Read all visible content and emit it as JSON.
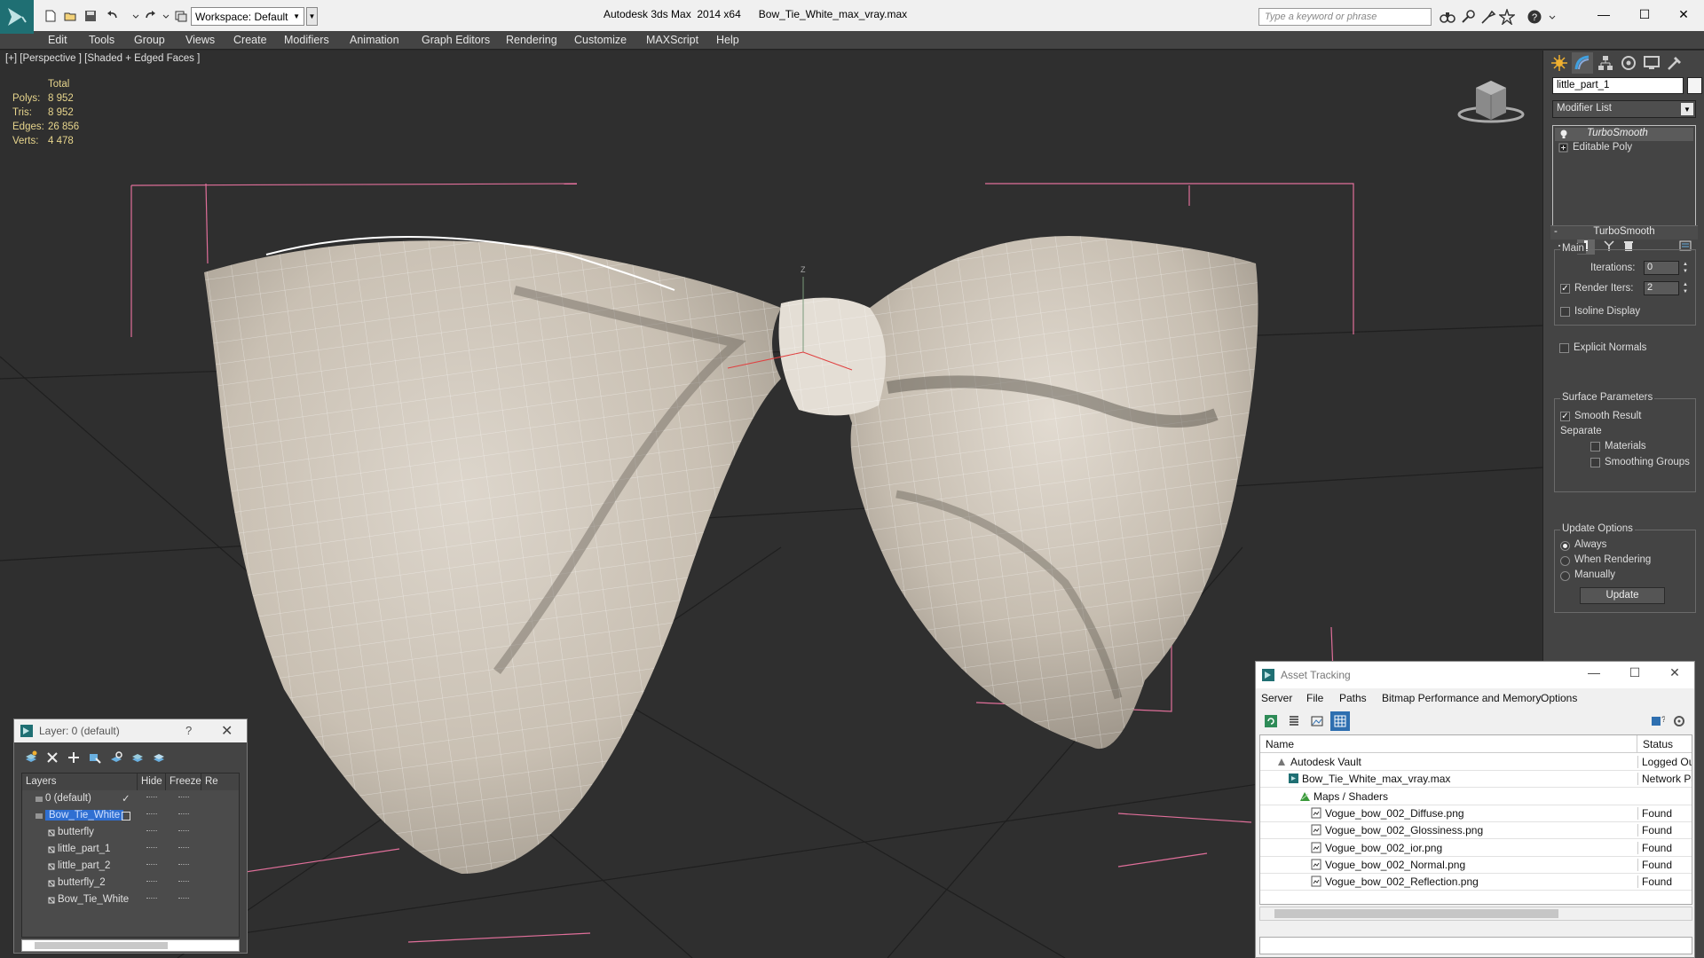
{
  "app": {
    "title": "Autodesk 3ds Max  2014 x64      Bow_Tie_White_max_vray.max",
    "workspace": "Workspace: Default",
    "search_placeholder": "Type a keyword or phrase",
    "accent_color": "#1f6f73"
  },
  "menu": [
    "Edit",
    "Tools",
    "Group",
    "Views",
    "Create",
    "Modifiers",
    "Animation",
    "Graph Editors",
    "Rendering",
    "Customize",
    "MAXScript",
    "Help"
  ],
  "viewport": {
    "label": "[+] [Perspective ] [Shaded + Edged Faces ]",
    "stats": {
      "header": "Total",
      "rows": [
        {
          "k": "Polys:",
          "v": "8 952"
        },
        {
          "k": "Tris:",
          "v": "8 952"
        },
        {
          "k": "Edges:",
          "v": "26 856"
        },
        {
          "k": "Verts:",
          "v": "4 478"
        }
      ]
    },
    "axis_label": "Z"
  },
  "command_panel": {
    "object_name": "little_part_1",
    "modifier_list": "Modifier List",
    "stack": [
      "TurboSmooth",
      "Editable Poly"
    ],
    "rollout_title": "TurboSmooth",
    "main_group": "Main",
    "iterations_label": "Iterations:",
    "iterations_value": "0",
    "render_iters_label": "Render Iters:",
    "render_iters_value": "2",
    "isoline_display": "Isoline Display",
    "explicit_normals": "Explicit Normals",
    "surface_group": "Surface Parameters",
    "smooth_result": "Smooth Result",
    "separate_label": "Separate",
    "materials": "Materials",
    "smoothing_groups": "Smoothing Groups",
    "update_group": "Update Options",
    "opt_always": "Always",
    "opt_when_rendering": "When Rendering",
    "opt_manually": "Manually",
    "update_button": "Update"
  },
  "layer_dialog": {
    "title": "Layer: 0 (default)",
    "help": "?",
    "columns": [
      "Layers",
      "Hide",
      "Freeze",
      "Re"
    ],
    "rows": [
      {
        "name": "0 (default)",
        "indent": 1,
        "selected": false,
        "checked": true
      },
      {
        "name": "Bow_Tie_White",
        "indent": 1,
        "selected": true,
        "checked": false
      },
      {
        "name": "butterfly",
        "indent": 2,
        "selected": false,
        "checked": false
      },
      {
        "name": "little_part_1",
        "indent": 2,
        "selected": false,
        "checked": false
      },
      {
        "name": "little_part_2",
        "indent": 2,
        "selected": false,
        "checked": false
      },
      {
        "name": "butterfly_2",
        "indent": 2,
        "selected": false,
        "checked": false
      },
      {
        "name": "Bow_Tie_White",
        "indent": 2,
        "selected": false,
        "checked": false
      }
    ]
  },
  "asset_dialog": {
    "title": "Asset Tracking",
    "menu": [
      "Server",
      "File",
      "Paths",
      "Bitmap Performance and Memory",
      "Options"
    ],
    "columns": [
      "Name",
      "Status"
    ],
    "rows": [
      {
        "name": "Autodesk Vault",
        "status": "Logged Out",
        "indent": 0,
        "icon": "vault-icon"
      },
      {
        "name": "Bow_Tie_White_max_vray.max",
        "status": "Network Path",
        "indent": 1,
        "icon": "max-file-icon"
      },
      {
        "name": "Maps / Shaders",
        "status": "",
        "indent": 2,
        "icon": "maps-icon"
      },
      {
        "name": "Vogue_bow_002_Diffuse.png",
        "status": "Found",
        "indent": 3,
        "icon": "bitmap-icon"
      },
      {
        "name": "Vogue_bow_002_Glossiness.png",
        "status": "Found",
        "indent": 3,
        "icon": "bitmap-icon"
      },
      {
        "name": "Vogue_bow_002_ior.png",
        "status": "Found",
        "indent": 3,
        "icon": "bitmap-icon"
      },
      {
        "name": "Vogue_bow_002_Normal.png",
        "status": "Found",
        "indent": 3,
        "icon": "bitmap-icon"
      },
      {
        "name": "Vogue_bow_002_Reflection.png",
        "status": "Found",
        "indent": 3,
        "icon": "bitmap-icon"
      }
    ]
  }
}
